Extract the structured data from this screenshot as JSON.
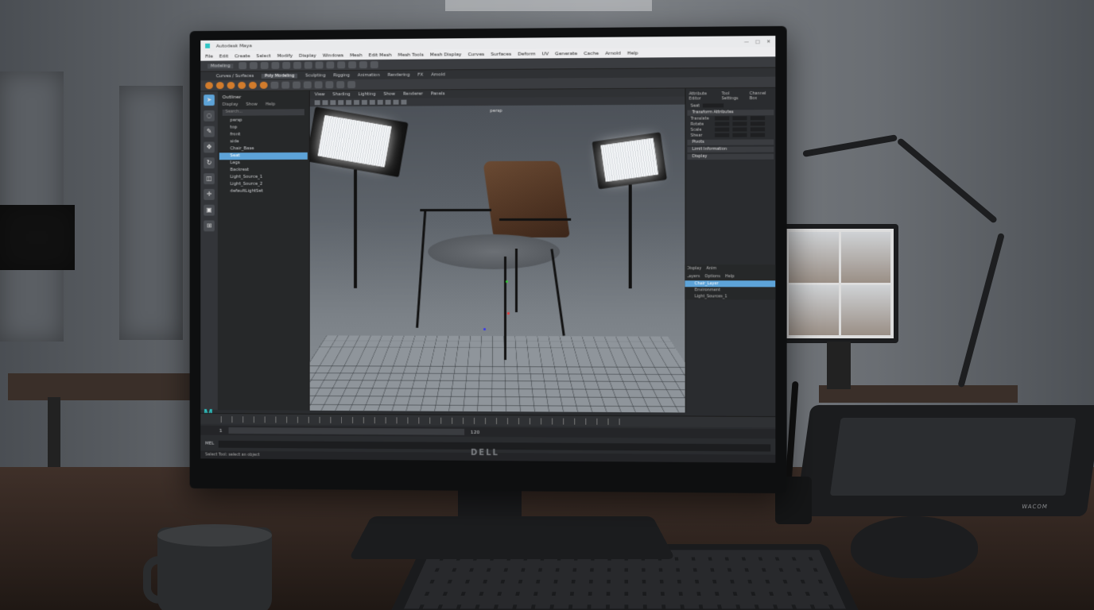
{
  "window": {
    "title": "Autodesk Maya",
    "controls": [
      "—",
      "□",
      "✕"
    ]
  },
  "menubar": [
    "File",
    "Edit",
    "Create",
    "Select",
    "Modify",
    "Display",
    "Windows",
    "Mesh",
    "Edit Mesh",
    "Mesh Tools",
    "Mesh Display",
    "Curves",
    "Surfaces",
    "Deform",
    "UV",
    "Generate",
    "Cache",
    "Arnold",
    "Help"
  ],
  "status_line": {
    "mode": "Modeling"
  },
  "shelf_tabs": [
    {
      "label": "Curves / Surfaces",
      "active": false
    },
    {
      "label": "Poly Modeling",
      "active": true
    },
    {
      "label": "Sculpting",
      "active": false
    },
    {
      "label": "Rigging",
      "active": false
    },
    {
      "label": "Animation",
      "active": false
    },
    {
      "label": "Rendering",
      "active": false
    },
    {
      "label": "FX",
      "active": false
    },
    {
      "label": "Arnold",
      "active": false
    }
  ],
  "outliner": {
    "title": "Outliner",
    "menu": [
      "Display",
      "Show",
      "Help"
    ],
    "search_placeholder": "Search...",
    "items": [
      {
        "label": "persp",
        "selected": false
      },
      {
        "label": "top",
        "selected": false
      },
      {
        "label": "front",
        "selected": false
      },
      {
        "label": "side",
        "selected": false
      },
      {
        "label": "Chair_Base",
        "selected": false
      },
      {
        "label": "Seat",
        "selected": true
      },
      {
        "label": "Legs",
        "selected": false
      },
      {
        "label": "Backrest",
        "selected": false
      },
      {
        "label": "Light_Source_1",
        "selected": false
      },
      {
        "label": "Light_Source_2",
        "selected": false
      },
      {
        "label": "defaultLightSet",
        "selected": false
      }
    ]
  },
  "viewport": {
    "menu": [
      "View",
      "Shading",
      "Lighting",
      "Show",
      "Renderer",
      "Panels"
    ],
    "camera_label": "persp"
  },
  "attribute_editor": {
    "tabs": [
      "Attribute Editor",
      "Tool Settings",
      "Channel Box"
    ],
    "node_label": "Seat",
    "sections": [
      "Transform Attributes",
      "Pivots",
      "Limit Information",
      "Display"
    ],
    "rows": [
      "Translate",
      "Rotate",
      "Scale",
      "Shear"
    ]
  },
  "layers": {
    "tabs": [
      "Display",
      "Anim"
    ],
    "menu": [
      "Layers",
      "Options",
      "Help"
    ],
    "items": [
      {
        "label": "Chair_Layer",
        "selected": true
      },
      {
        "label": "Environment",
        "selected": false
      },
      {
        "label": "Light_Sources_1",
        "selected": false
      }
    ]
  },
  "timeline": {
    "start": "1",
    "end": "120"
  },
  "command_line": {
    "label": "MEL"
  },
  "help_line": "Select Tool: select an object",
  "monitor_brand": "DELL",
  "tablet_brand": "WACOM",
  "app_logo": "M",
  "colors": {
    "selection": "#5da3d8",
    "shelf_icon": "#d27c2c",
    "ui_dark": "#2a2c2f"
  }
}
